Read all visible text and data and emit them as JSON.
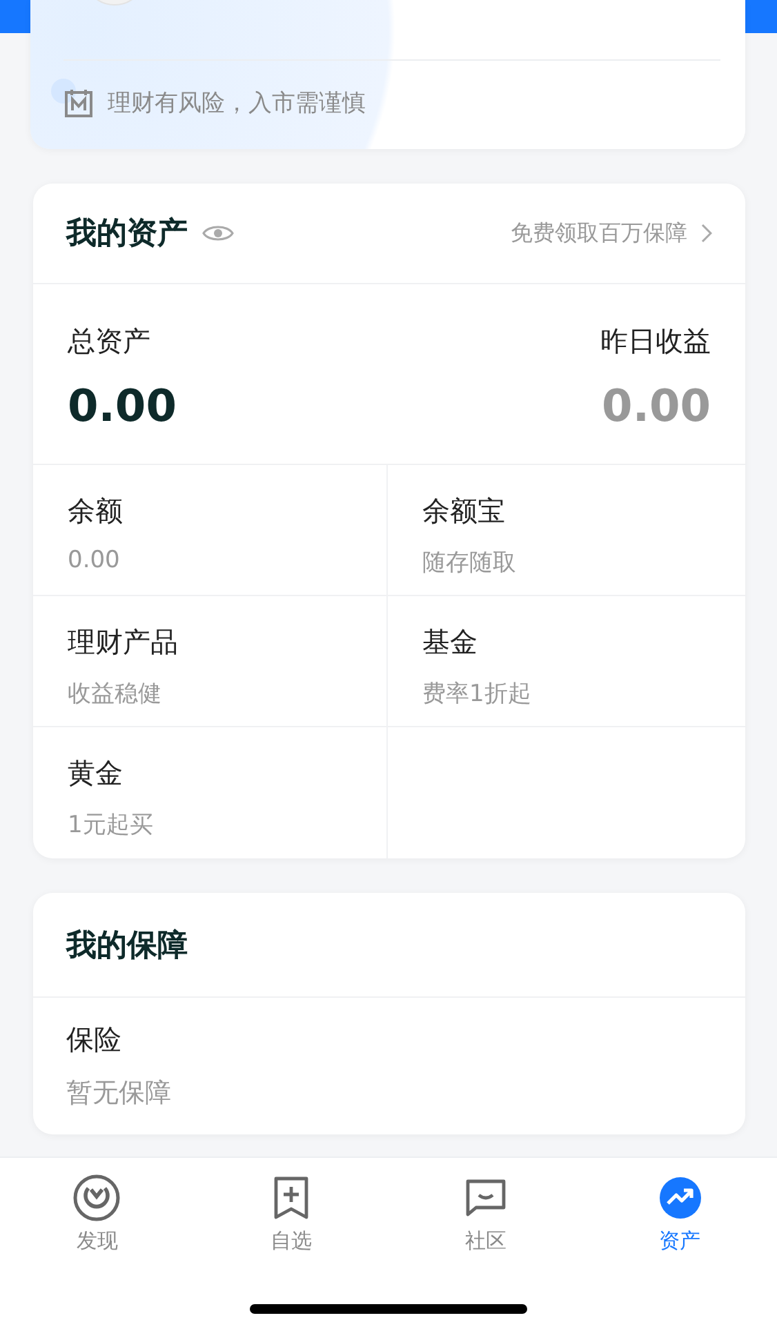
{
  "risk_notice": {
    "text": "理财有风险，入市需谨慎"
  },
  "assets": {
    "title": "我的资产",
    "promo_link": "免费领取百万保障",
    "total": {
      "label": "总资产",
      "value": "0.00"
    },
    "yesterday": {
      "label": "昨日收益",
      "value": "0.00"
    },
    "products": [
      {
        "name": "余额",
        "note": "0.00"
      },
      {
        "name": "余额宝",
        "note": "随存随取"
      },
      {
        "name": "理财产品",
        "note": "收益稳健"
      },
      {
        "name": "基金",
        "note": "费率1折起"
      },
      {
        "name": "黄金",
        "note": "1元起买"
      }
    ]
  },
  "protection": {
    "title": "我的保障",
    "items": [
      {
        "name": "保险",
        "note": "暂无保障"
      }
    ]
  },
  "tab_bar": [
    {
      "label": "发现",
      "selected": false
    },
    {
      "label": "自选",
      "selected": false
    },
    {
      "label": "社区",
      "selected": false
    },
    {
      "label": "资产",
      "selected": true
    }
  ]
}
